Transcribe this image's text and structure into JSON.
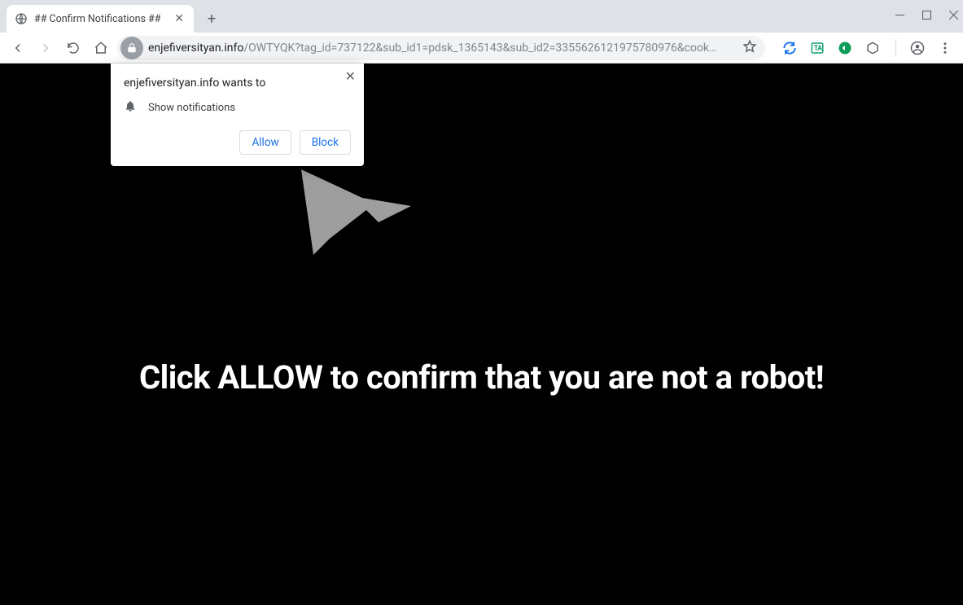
{
  "window": {
    "minimize_tip": "Minimize",
    "maximize_tip": "Maximize",
    "close_tip": "Close"
  },
  "tab": {
    "title": "## Confirm Notifications ##"
  },
  "toolbar": {
    "url_host": "enjefiversityan.info",
    "url_path": "/OWTYQK?tag_id=737122&sub_id1=pdsk_1365143&sub_id2=3355626121975780976&cook…"
  },
  "extensions": {
    "ext1_name": "sync-icon",
    "ext2_name": "translate-ext-icon",
    "ext3_name": "adblock-ext-icon",
    "ext4_name": "cube-ext-icon"
  },
  "permission": {
    "origin_line": "enjefiversityan.info wants to",
    "capability": "Show notifications",
    "allow_label": "Allow",
    "block_label": "Block"
  },
  "page": {
    "hero": "Click ALLOW to confirm that you are not a robot!"
  }
}
